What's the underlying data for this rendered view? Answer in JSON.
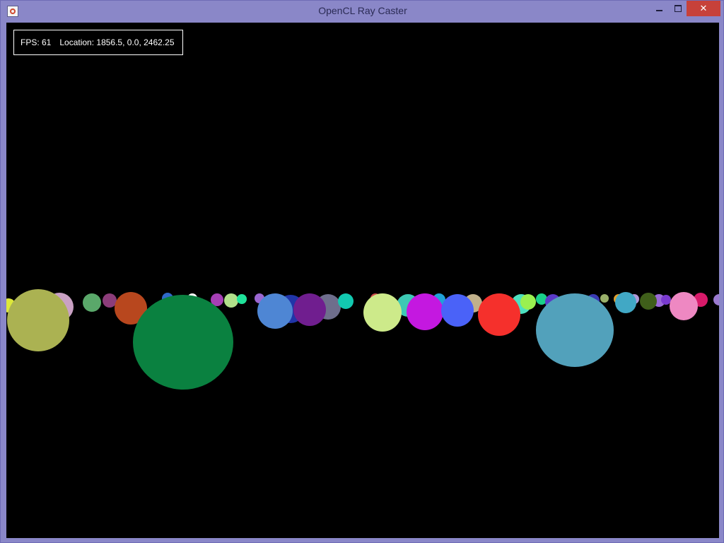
{
  "window": {
    "title": "OpenCL Ray Caster",
    "icon": "java-cup-icon",
    "controls": {
      "minimize": "minimize-icon",
      "maximize": "maximize-icon",
      "close": "close-icon"
    }
  },
  "hud": {
    "fps": "FPS: 61",
    "location": "Location: 1856.5, 0.0, 2462.25"
  },
  "colors": {
    "frame": "#8a87c8",
    "close_button": "#c7413a",
    "background": "#000000",
    "hud_text": "#ffffff"
  }
}
